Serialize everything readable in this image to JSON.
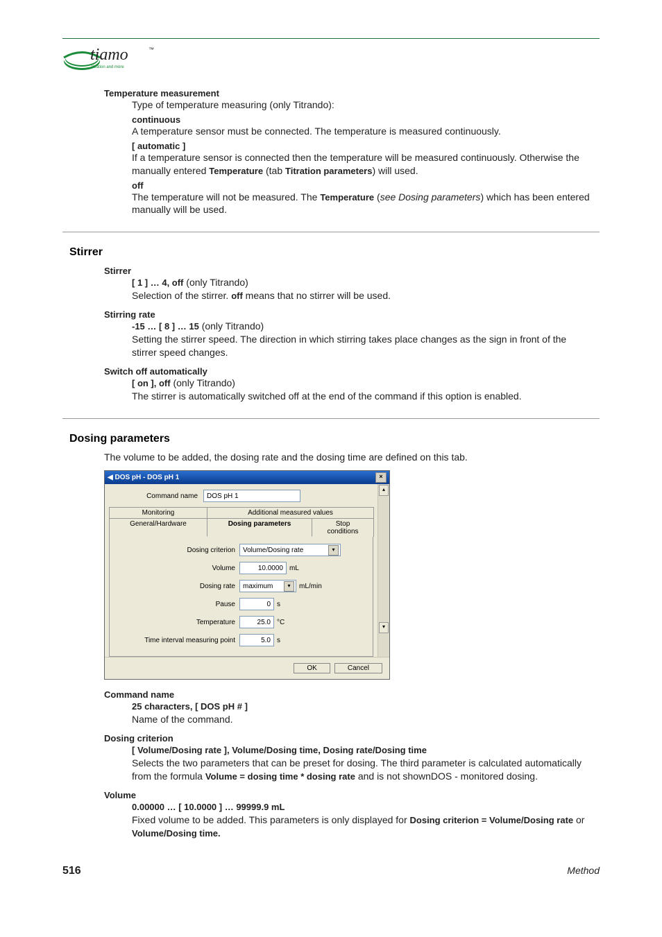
{
  "header": {
    "logo_text": "tiamo",
    "logo_sub": "titration and more"
  },
  "tempmeas": {
    "title": "Temperature measurement",
    "intro": "Type of temperature measuring (only Titrando):",
    "opt_cont_label": "continuous",
    "opt_cont_body": "A temperature sensor must be connected. The temperature is measured continuously.",
    "opt_auto_label": "[ automatic ]",
    "opt_auto_body_a": "If a temperature sensor is connected then the temperature will be measured continuously. Otherwise the manually entered ",
    "opt_auto_bold1": "Temperature",
    "opt_auto_body_b": " (tab ",
    "opt_auto_bold2": "Titration parameters",
    "opt_auto_body_c": ") will used.",
    "opt_off_label": "off",
    "opt_off_body_a": "The temperature will not be measured. The ",
    "opt_off_bold1": "Temperature",
    "opt_off_body_b": " (",
    "opt_off_italic": "see Dosing parameters",
    "opt_off_body_c": ") which has been entered manually will be used."
  },
  "stirrer": {
    "heading": "Stirrer",
    "p1_label": "Stirrer",
    "p1_opt": "[ 1 ] … 4, off",
    "p1_note": " (only Titrando)",
    "p1_body_a": "Selection of the stirrer. ",
    "p1_bold": "off",
    "p1_body_b": " means that no stirrer will be used.",
    "p2_label": "Stirring rate",
    "p2_opt": "-15 … [ 8 ] … 15",
    "p2_note": " (only Titrando)",
    "p2_body": "Setting the stirrer speed. The direction in which stirring takes place changes as the sign in front of the stirrer speed changes.",
    "p3_label": "Switch off automatically",
    "p3_opt": "[ on ], off",
    "p3_note": " (only Titrando)",
    "p3_body": "The stirrer is automatically switched off at the end of the command if this option is enabled."
  },
  "dosing": {
    "heading": "Dosing parameters",
    "intro": "The volume to be added, the dosing rate and the dosing time are defined on this tab."
  },
  "dialog": {
    "title": "DOS pH - DOS pH 1",
    "cmd_label": "Command name",
    "cmd_value": "DOS pH 1",
    "tabs": {
      "monitoring": "Monitoring",
      "addmeas": "Additional measured values",
      "general": "General/Hardware",
      "dosing": "Dosing parameters",
      "stop": "Stop conditions"
    },
    "f_dosing_crit_label": "Dosing criterion",
    "f_dosing_crit_value": "Volume/Dosing rate",
    "f_volume_label": "Volume",
    "f_volume_value": "10.0000",
    "f_volume_unit": "mL",
    "f_rate_label": "Dosing rate",
    "f_rate_value": "maximum",
    "f_rate_unit": "mL/min",
    "f_pause_label": "Pause",
    "f_pause_value": "0",
    "f_pause_unit": "s",
    "f_temp_label": "Temperature",
    "f_temp_value": "25.0",
    "f_temp_unit": "°C",
    "f_time_label": "Time interval measuring point",
    "f_time_value": "5.0",
    "f_time_unit": "s",
    "ok": "OK",
    "cancel": "Cancel"
  },
  "params_after": {
    "cmd_label": "Command name",
    "cmd_opt": "25 characters, [ DOS pH # ]",
    "cmd_body": "Name of the command.",
    "crit_label": "Dosing criterion",
    "crit_opt": "[ Volume/Dosing rate ], Volume/Dosing time, Dosing rate/Dosing time",
    "crit_body_a": "Selects the two parameters that can be preset for dosing. The third parameter is calculated automatically from the formula ",
    "crit_bold": "Volume = dosing time * dosing rate",
    "crit_body_b": " and is not shownDOS - monitored dosing.",
    "vol_label": "Volume",
    "vol_opt": "0.00000 … [ 10.0000 ] … 99999.9 mL",
    "vol_body_a": "Fixed volume to be added. This parameters is only displayed for ",
    "vol_bold1": "Dosing criterion = Volume/Dosing rate",
    "vol_body_b": " or ",
    "vol_bold2": "Volume/Dosing time."
  },
  "footer": {
    "page": "516",
    "section": "Method"
  }
}
